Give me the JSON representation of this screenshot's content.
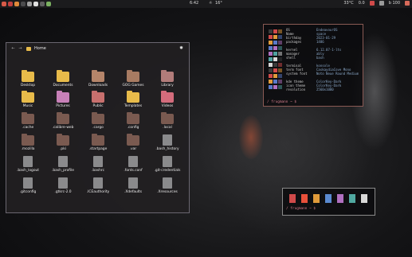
{
  "topbar": {
    "clock": "6:42",
    "weather": "16°",
    "temp": "33°C",
    "network": "0.0",
    "status_right": "b 100"
  },
  "file_manager": {
    "location": "Home",
    "items": [
      {
        "name": "Desktop",
        "kind": "folder",
        "color": "#e8bb4a"
      },
      {
        "name": "Documents",
        "kind": "folder",
        "color": "#e8bb4a"
      },
      {
        "name": "Downloads",
        "kind": "folder",
        "color": "#b5856a"
      },
      {
        "name": "GOG Games",
        "kind": "folder",
        "color": "#a87b62"
      },
      {
        "name": "Library",
        "kind": "folder",
        "color": "#b27c7a"
      },
      {
        "name": "Music",
        "kind": "folder",
        "color": "#e8bb4a"
      },
      {
        "name": "Pictures",
        "kind": "folder",
        "color": "#c880b8"
      },
      {
        "name": "Public",
        "kind": "folder",
        "color": "#c8706e"
      },
      {
        "name": "Templates",
        "kind": "folder",
        "color": "#e8bb4a"
      },
      {
        "name": "Videos",
        "kind": "folder",
        "color": "#d46c7c"
      },
      {
        "name": ".cache",
        "kind": "folder",
        "color": "#7a5a50"
      },
      {
        "name": ".calibre-web",
        "kind": "folder",
        "color": "#7a5a50"
      },
      {
        "name": ".cargo",
        "kind": "folder",
        "color": "#7a5a50"
      },
      {
        "name": ".config",
        "kind": "folder",
        "color": "#7a5a50"
      },
      {
        "name": ".local",
        "kind": "folder",
        "color": "#7a5a50"
      },
      {
        "name": ".mozilla",
        "kind": "folder",
        "color": "#7a5a50"
      },
      {
        "name": ".pki",
        "kind": "folder",
        "color": "#7a5a50"
      },
      {
        "name": ".startpage",
        "kind": "folder",
        "color": "#7a5a50"
      },
      {
        "name": ".var",
        "kind": "folder",
        "color": "#7a5a50"
      },
      {
        "name": ".bash_history",
        "kind": "file",
        "color": "#8a8a8c"
      },
      {
        "name": ".bash_logout",
        "kind": "file",
        "color": "#8a8a8c"
      },
      {
        "name": ".bash_profile",
        "kind": "file",
        "color": "#8a8a8c"
      },
      {
        "name": ".bashrc",
        "kind": "file",
        "color": "#8a8a8c"
      },
      {
        "name": ".fonts.conf",
        "kind": "file",
        "color": "#8a8a8c"
      },
      {
        "name": ".git-credentials",
        "kind": "file",
        "color": "#8a8a8c"
      },
      {
        "name": ".gitconfig",
        "kind": "file",
        "color": "#8a8a8c"
      },
      {
        "name": ".gtkrc-2.0",
        "kind": "file",
        "color": "#8a8a8c"
      },
      {
        "name": ".ICEauthority",
        "kind": "file",
        "color": "#8a8a8c"
      },
      {
        "name": ".Xdefaults",
        "kind": "file",
        "color": "#8a8a8c"
      },
      {
        "name": ".Xresources",
        "kind": "file",
        "color": "#8a8a8c"
      }
    ]
  },
  "neofetch": {
    "rows": [
      {
        "key": "OS",
        "value": "EndeavourOS"
      },
      {
        "key": "Name",
        "value": "space"
      },
      {
        "key": "birthday",
        "value": "2023-01-29"
      },
      {
        "key": "packages",
        "value": "1486"
      },
      {
        "key": "kernel",
        "value": "6.12.07-1-lts"
      },
      {
        "key": "manager",
        "value": "ably"
      },
      {
        "key": "shell",
        "value": "bash"
      },
      {
        "key": "terminal",
        "value": "konsole"
      },
      {
        "key": "term font",
        "value": "CaskaydiaCove Mono"
      },
      {
        "key": "system font",
        "value": "Noto Neue Round Medium"
      },
      {
        "key": "kde theme",
        "value": "ColorKey-Dark"
      },
      {
        "key": "icon theme",
        "value": "ColorKey-Dark"
      },
      {
        "key": "resolution",
        "value": "2560x1080"
      }
    ],
    "logo_colors": [
      "#3a3a3a",
      "#d04a4a",
      "#e09a3a",
      "#5a7ac8",
      "#b070c0",
      "#50a0a0",
      "#d8d8d8"
    ],
    "prompt": "/ frugmann ~ $"
  },
  "colorscript": {
    "swatches": [
      "#d04a4a",
      "#e8503a",
      "#e09a3a",
      "#5a8ad0",
      "#b070c0",
      "#50a8a0",
      "#d8d8d8"
    ],
    "prompt": "/ frugmann ~ $"
  },
  "colors": {
    "accent": "#d27c8c",
    "folder": "#e8bb4a"
  }
}
